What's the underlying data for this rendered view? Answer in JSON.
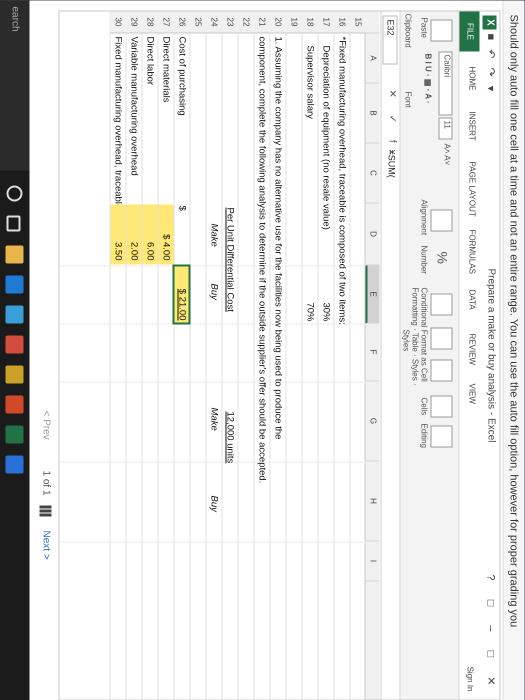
{
  "instruction": "Should only auto fill one cell at a time and not an entire range. You can use the auto fill option, however for proper grading you",
  "window": {
    "title": "Prepare a make or buy analysis - Excel",
    "app_logo": "X",
    "quick_access": "■ ↶ ↷ ▾",
    "controls": "? □ – □ ✕",
    "sign_in": "Sign In"
  },
  "tabs": [
    "FILE",
    "HOME",
    "INSERT",
    "PAGE LAYOUT",
    "FORMULAS",
    "DATA",
    "REVIEW",
    "VIEW"
  ],
  "ribbon": {
    "paste": "Paste",
    "clipboard": "Clipboard",
    "font_name": "Calibri",
    "font_size": "11",
    "font_group": "Font",
    "font_buttons": "B I U · ▦ · A ·",
    "font_size_buttons": "A˄ A˅",
    "alignment": "Alignment",
    "number": "Number",
    "number_symbol": "%",
    "conditional": "Conditional Format as Cell",
    "formatting": "Formatting · Table · Styles ·",
    "styles": "Styles",
    "cells": "Cells",
    "editing": "Editing"
  },
  "formula_bar": {
    "name_box": "E32",
    "icons": "✕ ✓ fx",
    "formula": "=SUM("
  },
  "columns": [
    "A",
    "B",
    "C",
    "D",
    "E",
    "F",
    "G",
    "H",
    "I"
  ],
  "rows": [
    {
      "n": "15",
      "a": "",
      "d": "",
      "e": "",
      "g": ""
    },
    {
      "n": "16",
      "a": "*Fixed manufacturing overhead, traceable is composed of two items:",
      "d": "",
      "e": "",
      "g": ""
    },
    {
      "n": "17",
      "a": "Depreciation of equipment (no resale value)",
      "d": "",
      "e": "30%",
      "g": ""
    },
    {
      "n": "18",
      "a": "Supervisor salary",
      "d": "",
      "e": "70%",
      "g": ""
    },
    {
      "n": "19",
      "a": "",
      "d": "",
      "e": "",
      "g": ""
    },
    {
      "n": "20",
      "a": "1. Assuming the company has no alternative use for the facilities now being used to produce the",
      "d": "",
      "e": "",
      "g": ""
    },
    {
      "n": "21",
      "a": "component, complete the following analysis to determine if the outside supplier's offer should be accepted.",
      "d": "",
      "e": "",
      "g": ""
    },
    {
      "n": "22",
      "a": "",
      "d": "",
      "e": "",
      "g": ""
    },
    {
      "n": "23",
      "a": "",
      "d": "Per Unit Differential Cost",
      "e": "",
      "g": "12,000 units"
    },
    {
      "n": "24",
      "a": "",
      "d": "Make",
      "e": "Buy",
      "g": "Make",
      "h": "Buy"
    },
    {
      "n": "25",
      "a": "",
      "d": "",
      "e": "",
      "g": ""
    },
    {
      "n": "26",
      "a": "Cost of purchasing",
      "d": "$",
      "e": "$ 21.00",
      "g": ""
    },
    {
      "n": "27",
      "a": "Direct materials",
      "d": "$ 4.00",
      "e": "",
      "g": ""
    },
    {
      "n": "28",
      "a": "Direct labor",
      "d": "6.00",
      "e": "",
      "g": ""
    },
    {
      "n": "29",
      "a": "Variable manufacturing overhead",
      "d": "2.00",
      "e": "",
      "g": ""
    },
    {
      "n": "30",
      "a": "Fixed manufacturing overhead, traceable",
      "d": "3.50",
      "e": "",
      "g": ""
    }
  ],
  "pager": {
    "prev": "< Prev",
    "page": "1 of 1",
    "next": "Next >"
  },
  "taskbar": {
    "search": "earch"
  }
}
